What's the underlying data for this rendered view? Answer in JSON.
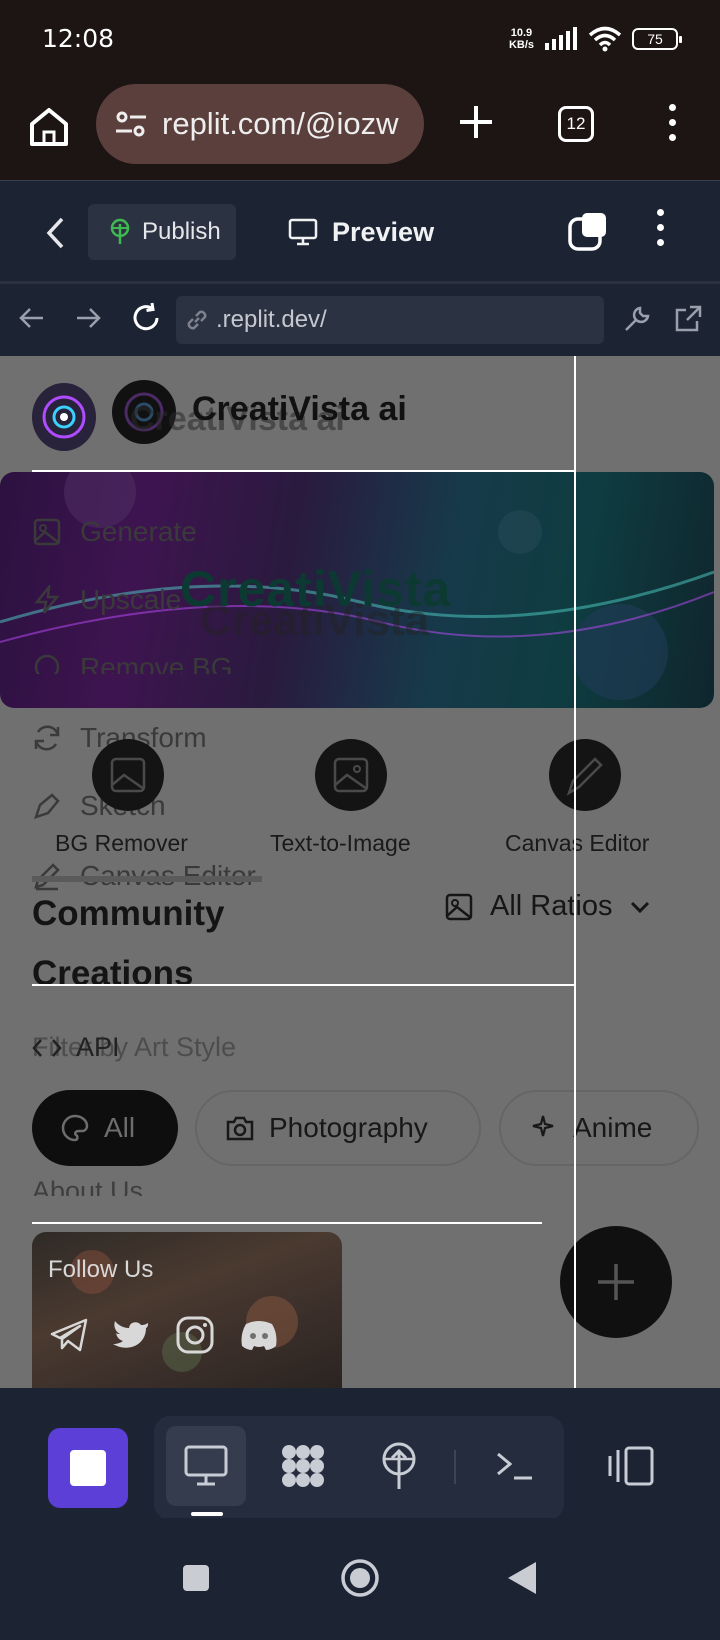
{
  "status_bar": {
    "time": "12:08",
    "net_speed_value": "10.9",
    "net_speed_unit": "KB/s",
    "battery": "75"
  },
  "browser": {
    "url": "replit.com/@iozw",
    "tab_count": "12"
  },
  "replit_header": {
    "publish_label": "Publish",
    "preview_label": "Preview"
  },
  "webview_nav": {
    "address": ".replit.dev/"
  },
  "page": {
    "brand_name": "CreatiVista ai",
    "brand_name_overlay": "CreatiVista ai",
    "banner_title": "CreatiVista",
    "banner_title_ghost": "CreatiVista",
    "drawer_menu": [
      "Generate",
      "Upscale",
      "Remove BG",
      "Transform",
      "Sketch",
      "Canvas Editor"
    ],
    "tools": [
      "BG Remover",
      "Text-to-Image",
      "Canvas Editor"
    ],
    "community_title": "Community Creations",
    "ratios_label": "All Ratios",
    "filter_label": "Filter by Art Style",
    "api_label": "API",
    "chips": [
      "All",
      "Photography",
      "Anime"
    ],
    "about_label": "About Us",
    "follow_title": "Follow Us",
    "socials": [
      "telegram-icon",
      "twitter-icon",
      "instagram-icon",
      "discord-icon"
    ]
  },
  "colors": {
    "accent_purple": "#5b3fd6",
    "publish_green": "#3fb950",
    "toolbar_bg": "#1c2333"
  }
}
